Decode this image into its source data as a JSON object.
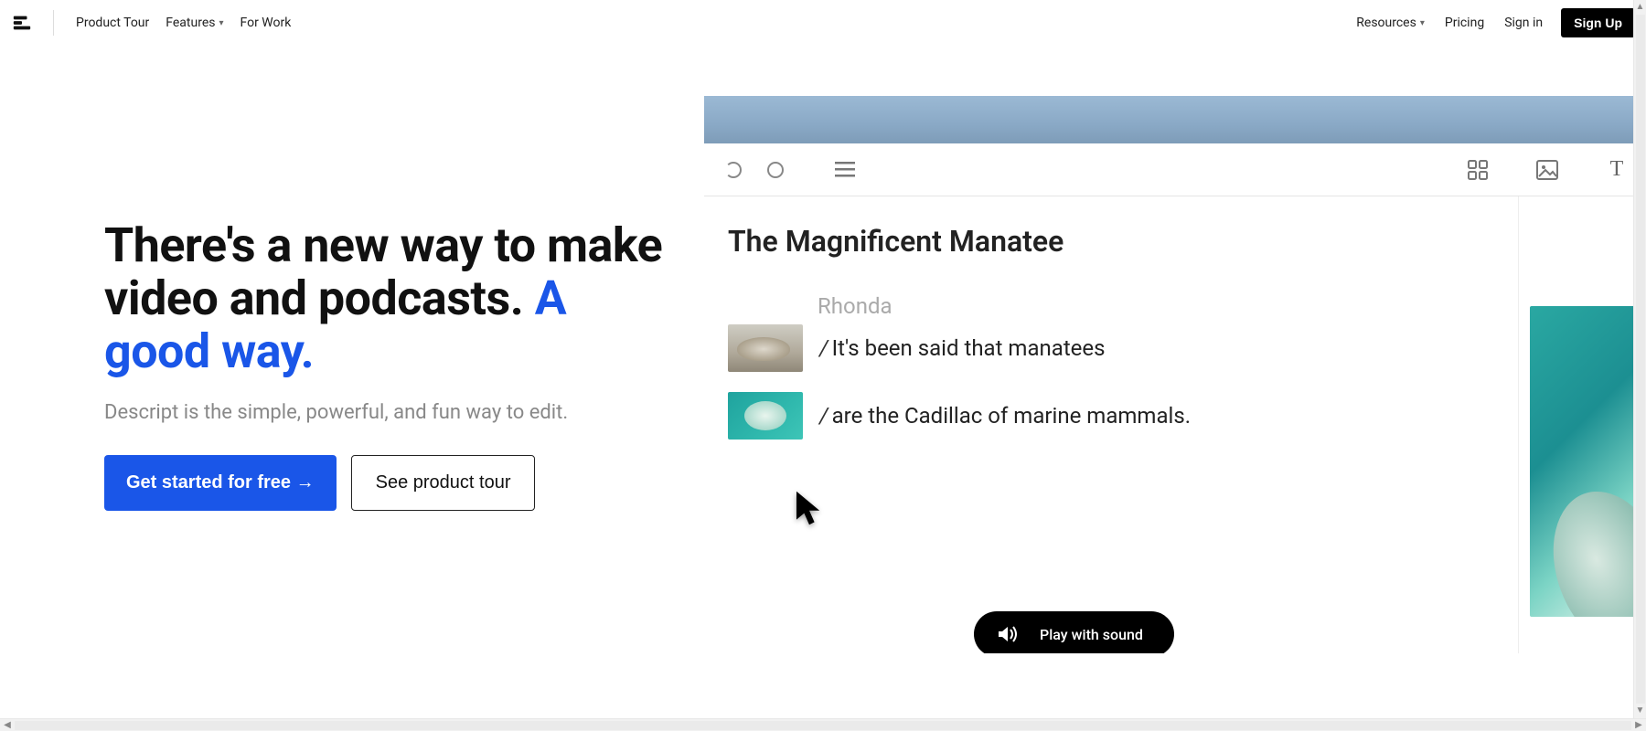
{
  "nav": {
    "product_tour": "Product Tour",
    "features": "Features",
    "for_work": "For Work",
    "resources": "Resources",
    "pricing": "Pricing",
    "sign_in": "Sign in",
    "sign_up": "Sign Up"
  },
  "hero": {
    "headline_a": "There's a new way to make video and podcasts. ",
    "headline_accent": "A good way.",
    "subhead": "Descript is the simple, powerful, and fun way to edit.",
    "cta_primary": "Get started for free →",
    "cta_secondary": "See product tour"
  },
  "demo": {
    "doc_title": "The Magnificent Manatee",
    "speaker": "Rhonda",
    "line1_slash": "/",
    "line1_text": "It's been said that manatees",
    "line2_slash": "/",
    "line2_text": "are the Cadillac of marine mammals.",
    "play_label": "Play with sound"
  }
}
